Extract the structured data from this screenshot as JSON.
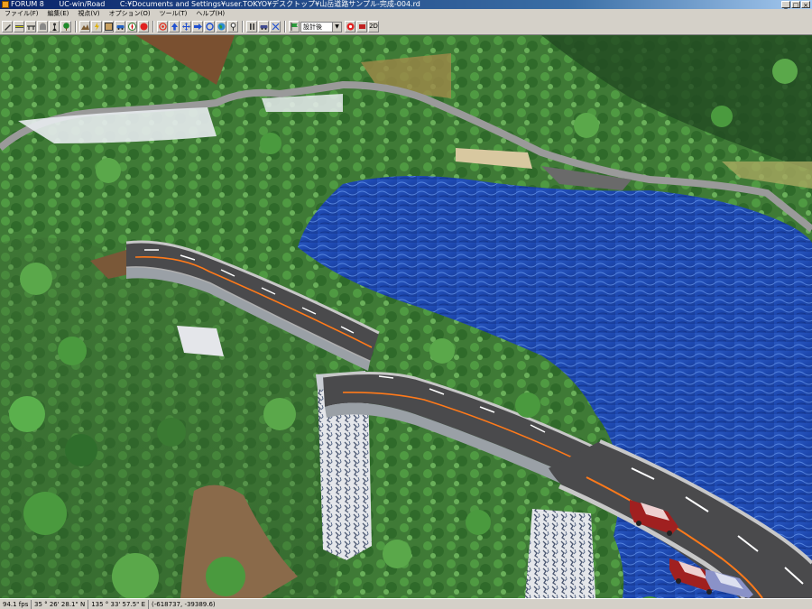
{
  "titlebar": {
    "app": "FORUM 8",
    "product": "UC-win/Road",
    "path": "C:¥Documents and Settings¥user.TOKYO¥デスクトップ¥山岳道路サンプル-完成-004.rd",
    "min": "_",
    "max": "□",
    "close": "×"
  },
  "menu": {
    "file": "ファイル(F)",
    "edit": "編集(E)",
    "view": "視点(V)",
    "options": "オプション(O)",
    "tools": "ツール(T)",
    "help": "ヘルプ(H)"
  },
  "toolbar": {
    "mode_select": "設計後",
    "view_2d": "2D"
  },
  "status": {
    "fps": "94.1 fps",
    "latitude": "35 ° 26' 28.1\" N",
    "longitude": "135 ° 33' 57.5\" E",
    "coords": "(-618737, -39389.6)"
  },
  "colors": {
    "titlebar_start": "#0a246a",
    "titlebar_end": "#a6caf0",
    "chrome": "#d4d0c8",
    "lake": "#1d48b0",
    "asphalt": "#4a4a4c",
    "center_line": "#ff7a1a"
  },
  "icons": [
    "pencil-icon",
    "road-icon",
    "bridge-icon",
    "tunnel-icon",
    "person-icon",
    "tree-icon",
    "terrain-icon",
    "lightning-icon",
    "texture-icon",
    "vehicle-icon",
    "compass-icon",
    "rotate-icon",
    "up-icon",
    "move-icon",
    "arrow-right-icon",
    "refresh-icon",
    "world-icon",
    "pin-icon",
    "pause-icon",
    "car-icon",
    "scenario-icon",
    "flag-icon",
    "camera-icon"
  ]
}
